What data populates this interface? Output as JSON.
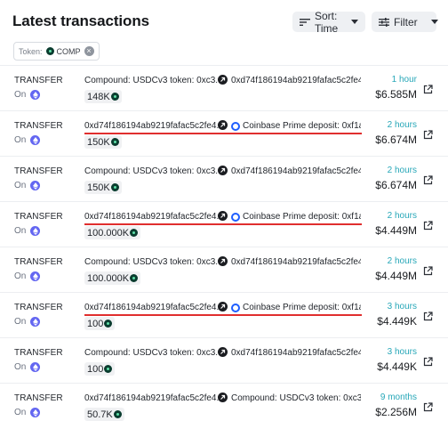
{
  "header": {
    "title": "Latest transactions",
    "sort_label": "Sort: Time",
    "filter_label": "Filter"
  },
  "filter_chip": {
    "key": "Token:",
    "value": "COMP"
  },
  "transactions": [
    {
      "type": "TRANSFER",
      "chain": "On",
      "from": "Compound: USDCv3 token: 0xc3...",
      "to": "0xd74f186194ab9219fafac5c2fe4...",
      "to_icon": "none",
      "amount": "148K",
      "time": "1 hour",
      "usd": "$6.585M",
      "highlighted": false
    },
    {
      "type": "TRANSFER",
      "chain": "On",
      "from": "0xd74f186194ab9219fafac5c2fe4...",
      "to": "Coinbase Prime deposit: 0xf1a...",
      "to_icon": "coinbase",
      "amount": "150K",
      "time": "2 hours",
      "usd": "$6.674M",
      "highlighted": true
    },
    {
      "type": "TRANSFER",
      "chain": "On",
      "from": "Compound: USDCv3 token: 0xc3...",
      "to": "0xd74f186194ab9219fafac5c2fe4...",
      "to_icon": "none",
      "amount": "150K",
      "time": "2 hours",
      "usd": "$6.674M",
      "highlighted": false
    },
    {
      "type": "TRANSFER",
      "chain": "On",
      "from": "0xd74f186194ab9219fafac5c2fe4...",
      "to": "Coinbase Prime deposit: 0xf1a...",
      "to_icon": "coinbase",
      "amount": "100.000K",
      "time": "2 hours",
      "usd": "$4.449M",
      "highlighted": true
    },
    {
      "type": "TRANSFER",
      "chain": "On",
      "from": "Compound: USDCv3 token: 0xc3...",
      "to": "0xd74f186194ab9219fafac5c2fe4...",
      "to_icon": "none",
      "amount": "100.000K",
      "time": "2 hours",
      "usd": "$4.449M",
      "highlighted": false
    },
    {
      "type": "TRANSFER",
      "chain": "On",
      "from": "0xd74f186194ab9219fafac5c2fe4...",
      "to": "Coinbase Prime deposit: 0xf1a...",
      "to_icon": "coinbase",
      "amount": "100",
      "time": "3 hours",
      "usd": "$4.449K",
      "highlighted": true
    },
    {
      "type": "TRANSFER",
      "chain": "On",
      "from": "Compound: USDCv3 token: 0xc3...",
      "to": "0xd74f186194ab9219fafac5c2fe4...",
      "to_icon": "none",
      "amount": "100",
      "time": "3 hours",
      "usd": "$4.449K",
      "highlighted": false
    },
    {
      "type": "TRANSFER",
      "chain": "On",
      "from": "0xd74f186194ab9219fafac5c2fe4...",
      "to": "Compound: USDCv3 token: 0xc3...",
      "to_icon": "none",
      "amount": "50.7K",
      "time": "9 months",
      "usd": "$2.256M",
      "highlighted": false
    }
  ],
  "colors": {
    "time_accent": "#27a7b8",
    "highlight_underline": "#e02e2e",
    "chain_icon": "#6366f1",
    "coinbase_blue": "#1e5eff"
  },
  "icons": {
    "sort": "sort-lines-icon",
    "filter": "filter-sliders-icon",
    "chain": "ethereum-icon",
    "token": "comp-token-icon",
    "direction": "arrow-up-right-icon",
    "external": "external-link-icon"
  }
}
